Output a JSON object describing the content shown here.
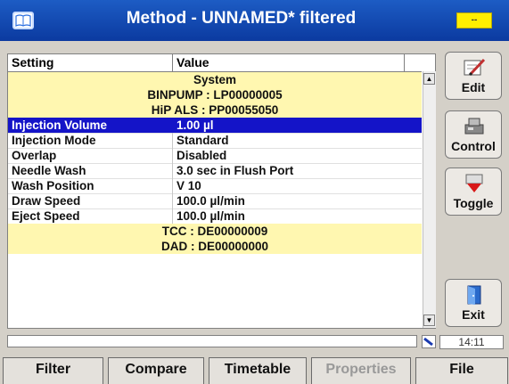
{
  "window": {
    "title": "Method - UNNAMED* filtered",
    "status_lamp_text": "--",
    "status_lamp_color": "#ffee00"
  },
  "table": {
    "headers": {
      "setting": "Setting",
      "value": "Value"
    },
    "group_rows": [
      "System",
      "BINPUMP : LP00000005",
      "HiP ALS : PP00055050",
      "TCC : DE00000009",
      "DAD : DE00000000"
    ],
    "rows": [
      {
        "setting": "Injection Volume",
        "value": "1.00 µl",
        "selected": true
      },
      {
        "setting": "Injection Mode",
        "value": "Standard"
      },
      {
        "setting": "Overlap",
        "value": "Disabled"
      },
      {
        "setting": "Needle Wash",
        "value": "3.0 sec in Flush Port"
      },
      {
        "setting": "Wash Position",
        "value": "V 10"
      },
      {
        "setting": "Draw Speed",
        "value": "100.0 µl/min"
      },
      {
        "setting": "Eject Speed",
        "value": "100.0 µl/min"
      }
    ]
  },
  "side_buttons": {
    "edit": "Edit",
    "control": "Control",
    "toggle": "Toggle",
    "exit": "Exit"
  },
  "status": {
    "clock": "14:11"
  },
  "tabs": {
    "filter": "Filter",
    "compare": "Compare",
    "timetable": "Timetable",
    "properties": "Properties",
    "file": "File"
  },
  "colors": {
    "titlebar": "#0b3aa0",
    "selection": "#1414c8",
    "group_row": "#fff7b0"
  }
}
